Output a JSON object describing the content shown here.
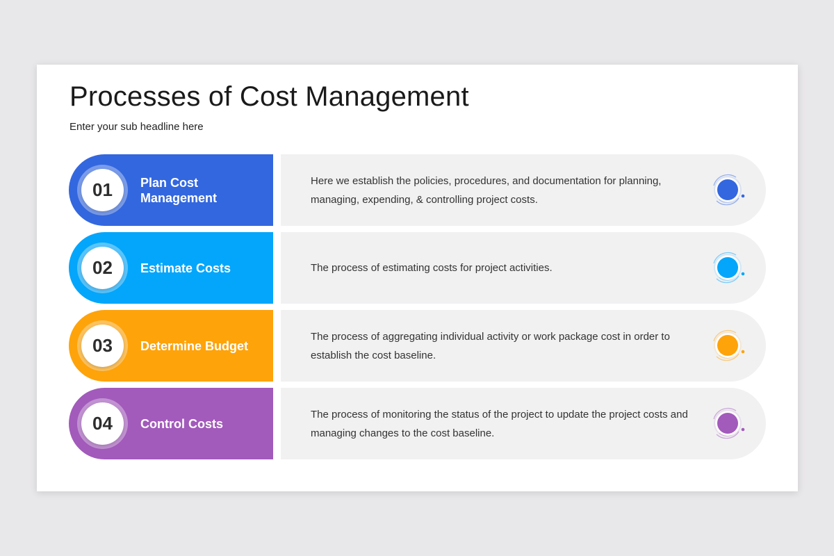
{
  "title": "Processes of Cost Management",
  "subtitle": "Enter your sub headline here",
  "steps": [
    {
      "number": "01",
      "label": "Plan Cost Management",
      "description": "Here we establish the policies, procedures, and documentation for planning, managing, expending, & controlling project costs.",
      "color": "#3367df",
      "icon": "target-dot-icon"
    },
    {
      "number": "02",
      "label": "Estimate Costs",
      "description": "The process of estimating costs for project activities.",
      "color": "#03a6fb",
      "icon": "target-dot-icon"
    },
    {
      "number": "03",
      "label": "Determine Budget",
      "description": "The process of aggregating individual activity or work package cost in order to establish the cost baseline.",
      "color": "#fea30a",
      "icon": "target-dot-icon"
    },
    {
      "number": "04",
      "label": "Control Costs",
      "description": "The process of monitoring the status of the project to update the project costs and managing changes to the cost baseline.",
      "color": "#a25abb",
      "icon": "target-dot-icon"
    }
  ]
}
